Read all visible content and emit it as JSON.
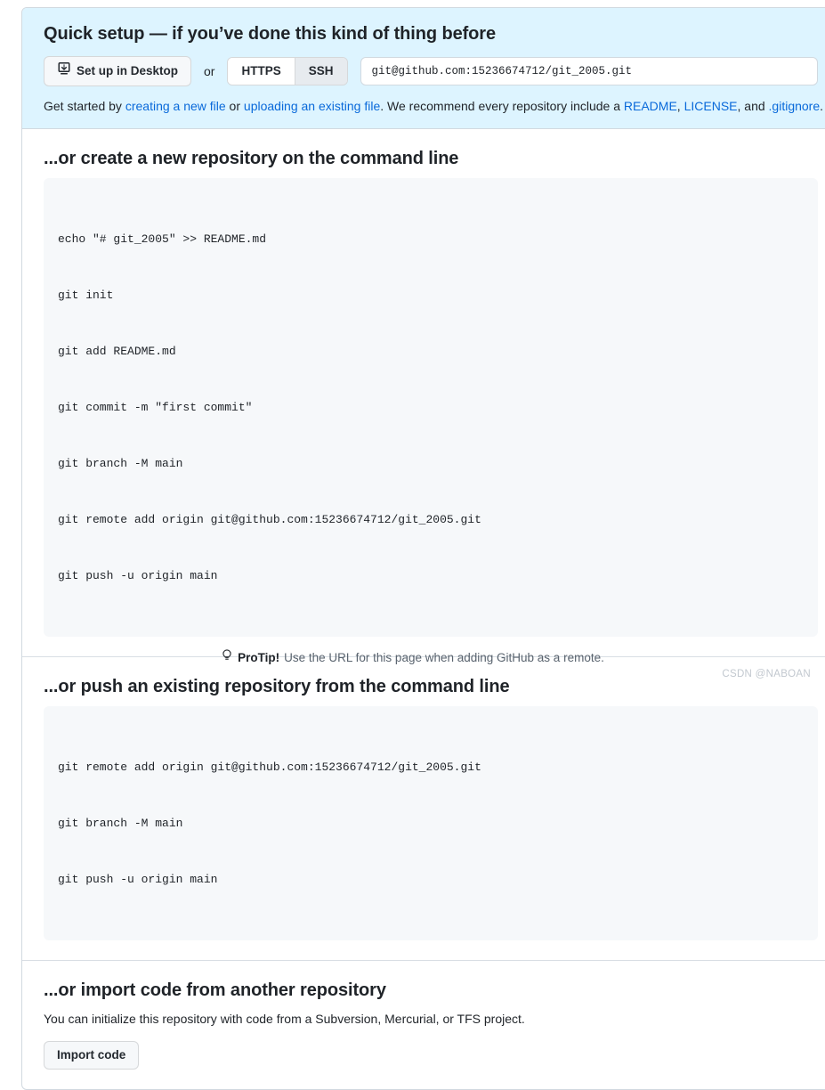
{
  "quick_setup": {
    "title": "Quick setup — if you’ve done this kind of thing before",
    "desktop_button": "Set up in Desktop",
    "or_label": "or",
    "protocol_https": "HTTPS",
    "protocol_ssh": "SSH",
    "selected_protocol": "SSH",
    "remote_url": "git@github.com:15236674712/git_2005.git",
    "get_started": {
      "prefix": "Get started by ",
      "link_new_file": "creating a new file",
      "mid": " or ",
      "link_upload": "uploading an existing file",
      "after": ". We recommend every repository include a ",
      "link_readme": "README",
      "sep1": ", ",
      "link_license": "LICENSE",
      "sep2": ", and ",
      "link_gitignore": ".gitignore",
      "end": "."
    },
    "header_bg": "#ddf4ff"
  },
  "create_section": {
    "title": "...or create a new repository on the command line",
    "lines": [
      "echo \"# git_2005\" >> README.md",
      "git init",
      "git add README.md",
      "git commit -m \"first commit\"",
      "git branch -M main",
      "git remote add origin git@github.com:15236674712/git_2005.git",
      "git push -u origin main"
    ]
  },
  "push_section": {
    "title": "...or push an existing repository from the command line",
    "lines": [
      "git remote add origin git@github.com:15236674712/git_2005.git",
      "git branch -M main",
      "git push -u origin main"
    ]
  },
  "import_section": {
    "title": "...or import code from another repository",
    "description": "You can initialize this repository with code from a Subversion, Mercurial, or TFS project.",
    "button": "Import code"
  },
  "footer": {
    "icon": "lightbulb-icon",
    "label": "ProTip!",
    "text": "Use the URL for this page when adding GitHub as a remote.",
    "watermark": "CSDN @NABOAN"
  },
  "colors": {
    "link": "#0969da",
    "code_bg": "#f6f8fa",
    "border": "#d1d9e0"
  }
}
